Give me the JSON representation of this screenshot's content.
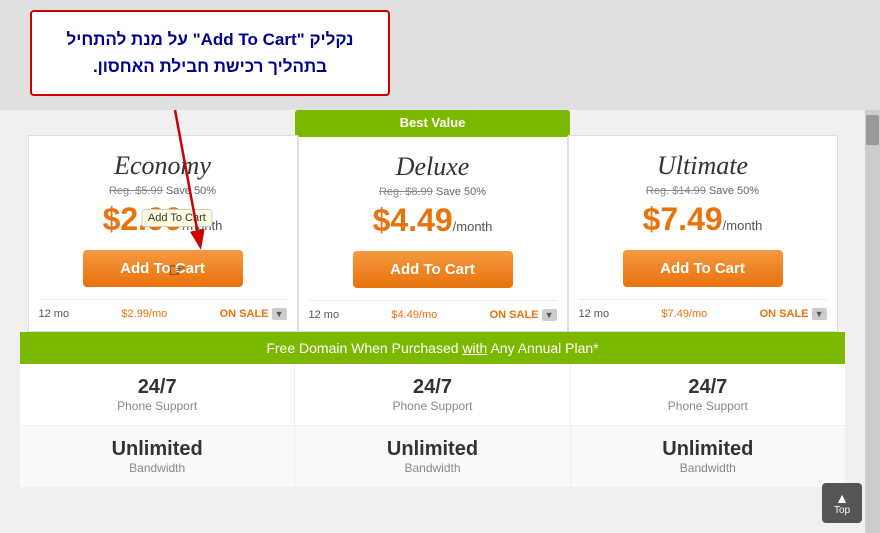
{
  "callout": {
    "text_line1": "נקליק \"Add To Cart\" על מנת להתחיל",
    "text_line2": "בתהליך רכישת חבילת האחסון."
  },
  "plans": [
    {
      "name": "Economy",
      "reg_price": "Reg. $5.99",
      "save": "Save 50%",
      "price": "$2.99",
      "period": "/month",
      "btn_label": "Add To Cart",
      "duration": "12 mo",
      "monthly": "$2.99/mo",
      "sale": "ON SALE"
    },
    {
      "name": "Deluxe",
      "best_value": "Best Value",
      "reg_price": "Reg. $8.99",
      "save": "Save 50%",
      "price": "$4.49",
      "period": "/month",
      "btn_label": "Add To Cart",
      "duration": "12 mo",
      "monthly": "$4.49/mo",
      "sale": "ON SALE"
    },
    {
      "name": "Ultimate",
      "reg_price": "Reg. $14.99",
      "save": "Save 50%",
      "price": "$7.49",
      "period": "/month",
      "btn_label": "Add To Cart",
      "duration": "12 mo",
      "monthly": "$7.49/mo",
      "sale": "ON SALE"
    }
  ],
  "free_domain": {
    "text_part1": "Free Domain When Purchased ",
    "text_underline": "with",
    "text_part2": " Any Annual Plan*"
  },
  "features": [
    {
      "main": "24/7",
      "sub": "Phone Support"
    },
    {
      "main": "24/7",
      "sub": "Phone Support"
    },
    {
      "main": "24/7",
      "sub": "Phone Support"
    }
  ],
  "features2": [
    {
      "main": "Unlimited",
      "sub": "Bandwidth"
    },
    {
      "main": "Unlimited",
      "sub": "Bandwidth"
    },
    {
      "main": "Unlimited",
      "sub": "Bandwidth"
    }
  ],
  "tooltip": "Add To Cart",
  "top_button": {
    "arrow": "▲",
    "label": "Top"
  }
}
